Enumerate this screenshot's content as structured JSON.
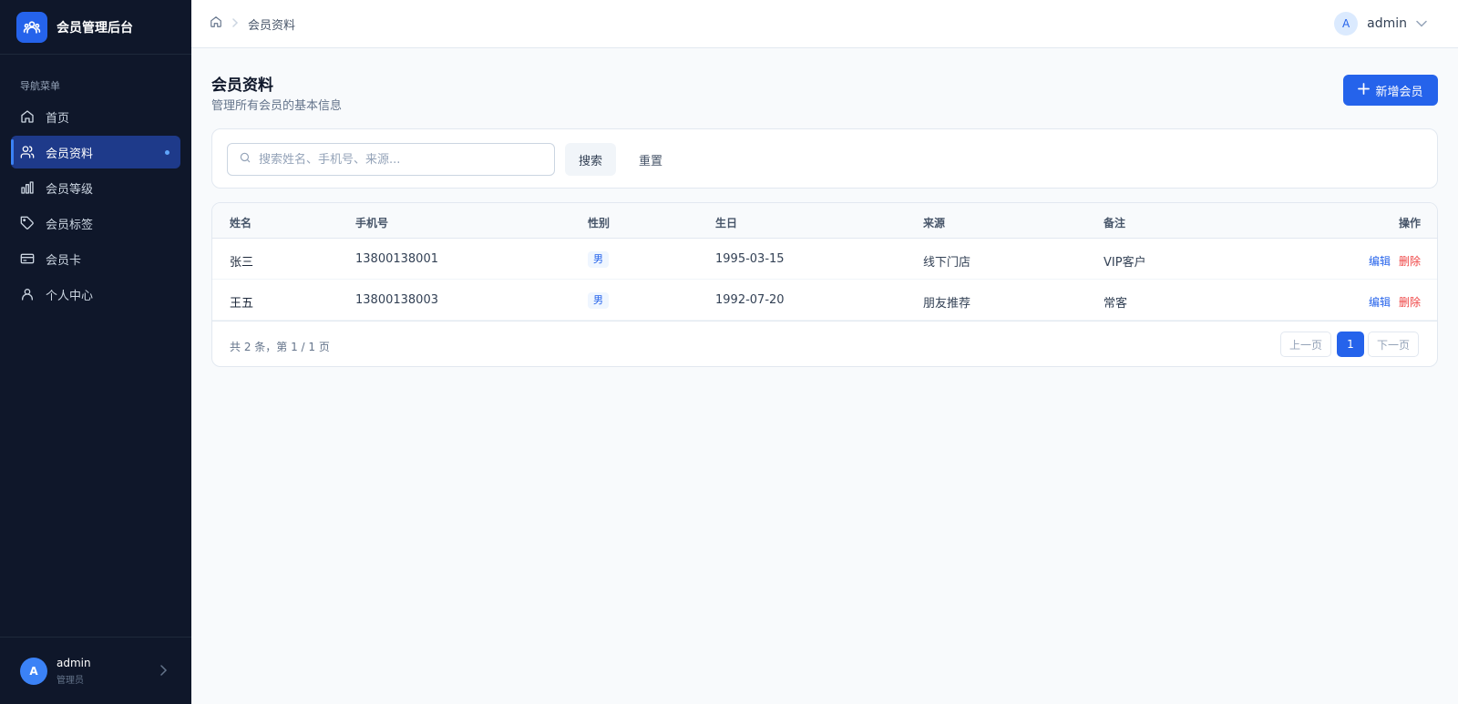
{
  "app": {
    "brand_title": "会员管理后台",
    "logo_icon": "users-group-icon",
    "accent_color": "#2563eb"
  },
  "sidebar": {
    "section_label": "导航菜单",
    "items": [
      {
        "label": "首页",
        "icon": "home-icon",
        "active": false
      },
      {
        "label": "会员资料",
        "icon": "users-icon",
        "active": true
      },
      {
        "label": "会员等级",
        "icon": "bar-chart-icon",
        "active": false
      },
      {
        "label": "会员标签",
        "icon": "tag-icon",
        "active": false
      },
      {
        "label": "会员卡",
        "icon": "card-icon",
        "active": false
      },
      {
        "label": "个人中心",
        "icon": "user-icon",
        "active": false
      }
    ],
    "user": {
      "avatar_letter": "A",
      "name": "admin",
      "role": "管理员"
    }
  },
  "header": {
    "breadcrumb": {
      "current": "会员资料"
    },
    "user": {
      "avatar_letter": "A",
      "name": "admin"
    }
  },
  "main": {
    "title": "会员资料",
    "subtitle": "管理所有会员的基本信息",
    "add_button_label": "新增会员",
    "search": {
      "placeholder": "搜索姓名、手机号、来源...",
      "value": "",
      "search_label": "搜索",
      "reset_label": "重置"
    },
    "table": {
      "columns": [
        "姓名",
        "手机号",
        "性别",
        "生日",
        "来源",
        "备注",
        "操作"
      ],
      "rows": [
        {
          "name": "张三",
          "phone": "13800138001",
          "gender": "男",
          "birthday": "1995-03-15",
          "source": "线下门店",
          "note": "VIP客户",
          "edit": "编辑",
          "delete": "删除"
        },
        {
          "name": "王五",
          "phone": "13800138003",
          "gender": "男",
          "birthday": "1992-07-20",
          "source": "朋友推荐",
          "note": "常客",
          "edit": "编辑",
          "delete": "删除"
        }
      ]
    },
    "pagination": {
      "summary": "共 2 条，第 1 / 1 页",
      "prev": "上一页",
      "current": "1",
      "next": "下一页"
    }
  }
}
